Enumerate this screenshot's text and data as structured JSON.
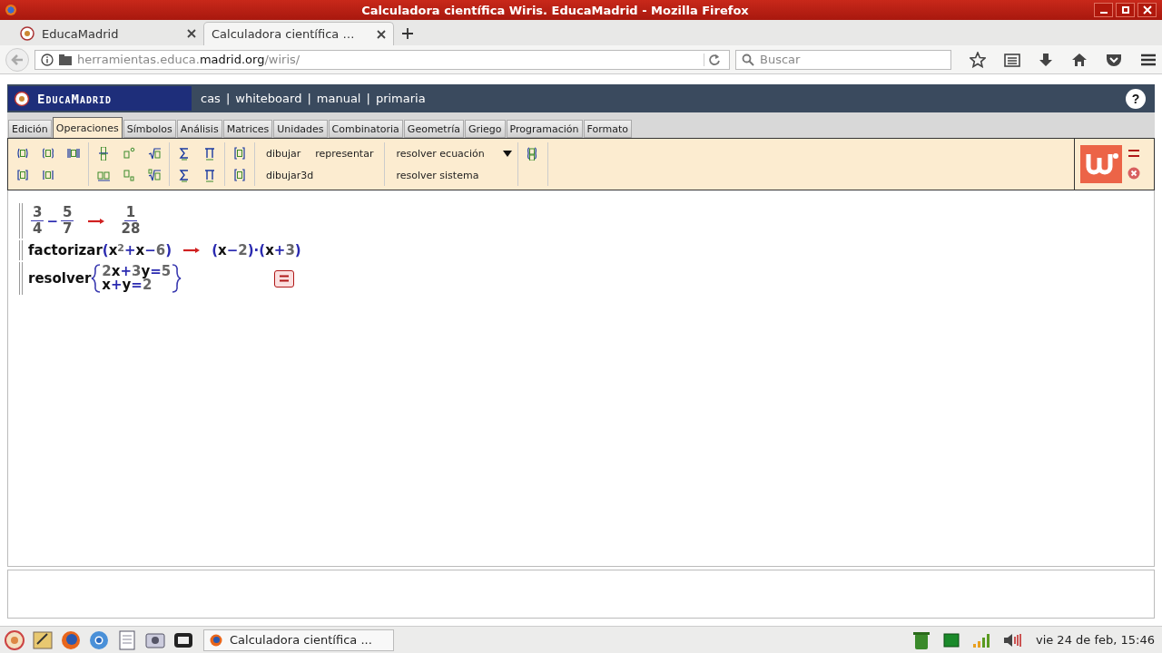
{
  "window": {
    "title": "Calculadora científica Wiris. EducaMadrid - Mozilla Firefox"
  },
  "browser_tabs": [
    {
      "label": "EducaMadrid",
      "selected": false
    },
    {
      "label": "Calculadora científica …",
      "selected": true
    }
  ],
  "address": {
    "url": "herramientas.educa.**madrid.org**/wiris/"
  },
  "search": {
    "placeholder": "Buscar"
  },
  "site_header": {
    "logo": "EducaMadrid",
    "links": [
      "cas",
      "whiteboard",
      "manual",
      "primaria"
    ],
    "separator": "|",
    "help": "?"
  },
  "wiris_tabs": [
    {
      "label": "Edición",
      "selected": false
    },
    {
      "label": "Operaciones",
      "selected": true
    },
    {
      "label": "Símbolos",
      "selected": false
    },
    {
      "label": "Análisis",
      "selected": false
    },
    {
      "label": "Matrices",
      "selected": false
    },
    {
      "label": "Unidades",
      "selected": false
    },
    {
      "label": "Combinatoria",
      "selected": false
    },
    {
      "label": "Geometría",
      "selected": false
    },
    {
      "label": "Griego",
      "selected": false
    },
    {
      "label": "Programación",
      "selected": false
    },
    {
      "label": "Formato",
      "selected": false
    }
  ],
  "toolbar": {
    "commands_top": [
      "dibujar",
      "representar"
    ],
    "commands_bottom": [
      "dibujar3d"
    ],
    "solve_top": "resolver ecuación",
    "solve_bottom": "resolver sistema"
  },
  "worksheet": [
    {
      "tokens": [
        {
          "kind": "frac",
          "num": "3",
          "den": "4"
        },
        {
          "kind": "sym",
          "text": "−"
        },
        {
          "kind": "frac",
          "num": "5",
          "den": "7"
        },
        {
          "kind": "arrow"
        },
        {
          "kind": "frac",
          "num": "1",
          "den": "28"
        }
      ]
    },
    {
      "tokens": [
        {
          "kind": "fn",
          "text": "factorizar"
        },
        {
          "kind": "sym",
          "text": "("
        },
        {
          "kind": "var",
          "text": "x"
        },
        {
          "kind": "sup",
          "text": "2"
        },
        {
          "kind": "sym",
          "text": "+"
        },
        {
          "kind": "var",
          "text": "x"
        },
        {
          "kind": "sym",
          "text": "−"
        },
        {
          "kind": "num",
          "text": "6"
        },
        {
          "kind": "sym",
          "text": ")"
        },
        {
          "kind": "arrow"
        },
        {
          "kind": "sym",
          "text": "("
        },
        {
          "kind": "var",
          "text": "x"
        },
        {
          "kind": "sym",
          "text": "−"
        },
        {
          "kind": "num",
          "text": "2"
        },
        {
          "kind": "sym",
          "text": ")·("
        },
        {
          "kind": "var",
          "text": "x"
        },
        {
          "kind": "sym",
          "text": "+"
        },
        {
          "kind": "num",
          "text": "3"
        },
        {
          "kind": "sym",
          "text": ")"
        }
      ]
    },
    {
      "tokens": [
        {
          "kind": "fn",
          "text": "resolver"
        },
        {
          "kind": "system",
          "rows": [
            [
              {
                "kind": "num",
                "text": "2"
              },
              {
                "kind": "var",
                "text": "x"
              },
              {
                "kind": "sym",
                "text": "+"
              },
              {
                "kind": "num",
                "text": "3"
              },
              {
                "kind": "var",
                "text": "y"
              },
              {
                "kind": "sym",
                "text": "="
              },
              {
                "kind": "num",
                "text": "5"
              }
            ],
            [
              {
                "kind": "var",
                "text": "x"
              },
              {
                "kind": "sym",
                "text": "+"
              },
              {
                "kind": "var",
                "text": "y"
              },
              {
                "kind": "sym",
                "text": "="
              },
              {
                "kind": "num",
                "text": "2"
              }
            ]
          ]
        }
      ],
      "calculate_button": true
    }
  ],
  "taskbar": {
    "window_button": "Calculadora científica ...",
    "clock": "vie 24 de feb, 15:46"
  }
}
